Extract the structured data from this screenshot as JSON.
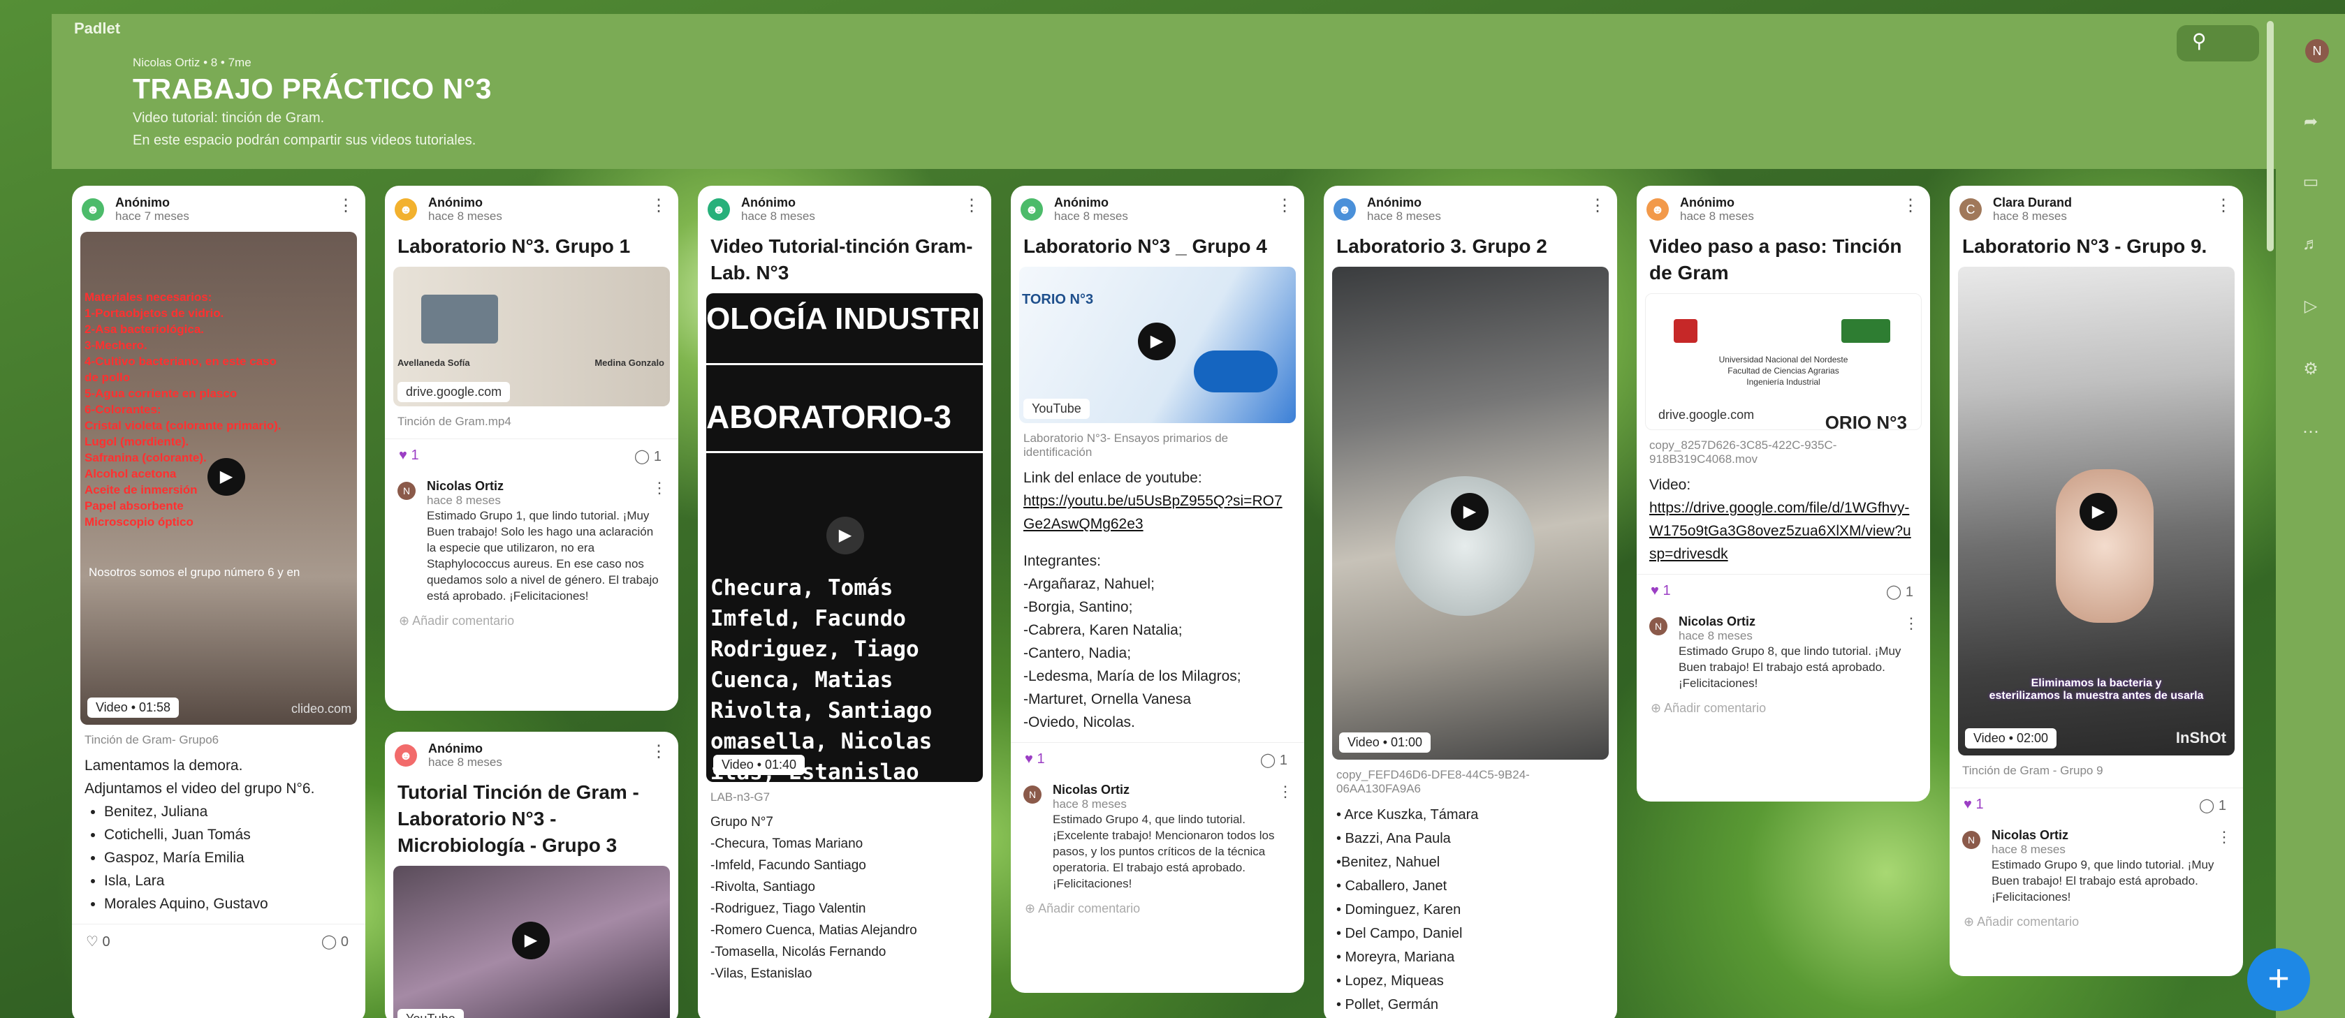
{
  "app": {
    "logo": "Padlet",
    "author_line": "Nicolas Ortiz • 8 • 7me",
    "title": "TRABAJO PRÁCTICO N°3",
    "sub1": "Video tutorial: tinción de Gram.",
    "sub2": "En este espacio podrán compartir sus videos tutoriales.",
    "avatar": "N",
    "fab": "+"
  },
  "icons": {
    "search": "search-icon",
    "share": "share-icon",
    "slideshow": "slideshow-icon",
    "bell": "bell-icon",
    "play": "play-icon",
    "settings": "gear-icon",
    "more": "more-icon"
  },
  "colors": {
    "header": "#7bab55",
    "heart": "#9b3ec4",
    "fab": "#1e88e5"
  },
  "cards": [
    {
      "author": "Anónimo",
      "time": "hace 7 meses",
      "overlay_text": [
        "Materiales necesarios:",
        "1-Portaobjetos de vidrio.",
        "2-Asa bacteriológica.",
        "3-Mechero.",
        "4-Cultivo bacteriano, en este caso",
        "de pollo",
        "5-Agua corriente en plasco",
        "6-Colorantes:",
        "Cristal violeta (colorante primario).",
        "Lugol (mordiente).",
        "Safranina (colorante).",
        "Alcohol acetona",
        "Aceite de inmersión",
        "Papel absorbente",
        "Microscopio óptico"
      ],
      "caption": "Nosotros somos el grupo número 6 y en",
      "badge": "Video • 01:58",
      "watermark": "clideo.com",
      "file": "Tinción de Gram- Grupo6",
      "text1": "Lamentamos la demora.",
      "text2": "Adjuntamos el video del grupo N°6.",
      "list": [
        "Benitez, Juliana",
        "Cotichelli, Juan Tomás",
        "Gaspoz, María Emilia",
        "Isla, Lara",
        "Morales Aquino, Gustavo"
      ],
      "likes": "0",
      "comments": "0"
    },
    {
      "author": "Anónimo",
      "time": "hace 8 meses",
      "title": "Laboratorio N°3. Grupo 1",
      "thumb_left": "Avellaneda Sofía",
      "thumb_right": "Medina Gonzalo",
      "domain": "drive.google.com",
      "file": "Tinción de Gram.mp4",
      "likes": "1",
      "comments": "1",
      "c_name": "Nicolas Ortiz",
      "c_time": "hace 8 meses",
      "c_body": "Estimado Grupo 1, que lindo tutorial. ¡Muy Buen trabajo! Solo les hago una aclaración la especie que utilizaron, no era Staphylococcus aureus. En ese caso nos quedamos solo a nivel de género. El trabajo está aprobado. ¡Felicitaciones!",
      "add": "Añadir comentario"
    },
    {
      "author": "Anónimo",
      "time": "hace 8 meses",
      "title": "Tutorial Tinción de Gram - Laboratorio N°3 - Microbiología - Grupo 3",
      "domain": "YouTube"
    },
    {
      "author": "Anónimo",
      "time": "hace 8 meses",
      "title": "Video Tutorial-tinción Gram-Lab. N°3",
      "big1": "OLOGÍA INDUSTRI",
      "big2": "ABORATORIO-3",
      "names": [
        "Checura, Tomás",
        "Imfeld, Facundo",
        "Rodriguez, Tiago",
        "Cuenca, Matias",
        "Rivolta, Santiago",
        "omasella, Nicolas",
        "ilas, Estanislao"
      ],
      "badge": "Video • 01:40",
      "file": "LAB-n3-G7",
      "group": "Grupo N°7",
      "list": [
        "-Checura, Tomas Mariano",
        "-Imfeld, Facundo Santiago",
        "-Rivolta, Santiago",
        "-Rodriguez, Tiago Valentin",
        "-Romero Cuenca, Matias Alejandro",
        "-Tomasella, Nicolás Fernando",
        "-Vilas, Estanislao"
      ]
    },
    {
      "author": "Anónimo",
      "time": "hace 8 meses",
      "title": "Laboratorio N°3 _ Grupo 4",
      "thumb": "TORIO N°3",
      "domain": "YouTube",
      "file": "Laboratorio N°3- Ensayos primarios de identificación",
      "link_label": "Link del enlace de youtube:",
      "link": "https://youtu.be/u5UsBpZ955Q?si=RO7Ge2AswQMg62e3",
      "integ": "Integrantes:",
      "list": [
        "-Argañaraz, Nahuel;",
        "-Borgia, Santino;",
        "-Cabrera, Karen Natalia;",
        "-Cantero, Nadia;",
        "-Ledesma, María de los Milagros;",
        "-Marturet, Ornella Vanesa",
        "-Oviedo, Nicolas."
      ],
      "likes": "1",
      "comments": "1",
      "c_name": "Nicolas Ortiz",
      "c_time": "hace 8 meses",
      "c_body": "Estimado Grupo 4, que lindo tutorial. ¡Excelente trabajo! Mencionaron todos los pasos, y los puntos críticos de la técnica operatoria. El trabajo está aprobado. ¡Felicitaciones!",
      "add": "Añadir comentario"
    },
    {
      "author": "Anónimo",
      "time": "hace 8 meses",
      "title": "Laboratorio 3. Grupo 2",
      "badge": "Video • 01:00",
      "file": "copy_FEFD46D6-DFE8-44C5-9B24-06AA130FA9A6",
      "list": [
        "• Arce Kuszka, Támara",
        "• Bazzi, Ana Paula",
        "•Benitez, Nahuel",
        "• Caballero, Janet",
        "• Dominguez, Karen",
        "• Del Campo, Daniel",
        "• Moreyra, Mariana",
        "• Lopez, Miqueas",
        "• Pollet, Germán"
      ]
    },
    {
      "author": "Anónimo",
      "time": "hace 8 meses",
      "title": "Video paso a paso: Tinción de Gram",
      "uni1": "Universidad Nacional del Nordeste",
      "uni2": "Facultad de Ciencias Agrarias",
      "uni3": "Ingeniería Industrial",
      "tag": "ORIO N°3",
      "domain": "drive.google.com",
      "file": "copy_8257D626-3C85-422C-935C-918B319C4068.mov",
      "video_label": "Video:",
      "link": "https://drive.google.com/file/d/1WGfhvy-W175o9tGa3G8ovez5zua6XlXM/view?usp=drivesdk",
      "likes": "1",
      "comments": "1",
      "c_name": "Nicolas Ortiz",
      "c_time": "hace 8 meses",
      "c_body": "Estimado Grupo 8, que lindo tutorial. ¡Muy Buen trabajo! El trabajo está aprobado. ¡Felicitaciones!",
      "add": "Añadir comentario"
    },
    {
      "author": "Clara Durand",
      "time": "hace 8 meses",
      "title": "Laboratorio N°3 - Grupo 9.",
      "overlay": "Eliminamos la bacteria  y",
      "overlay2": "esterilizamos la muestra antes de usarla",
      "badge": "Video • 02:00",
      "watermark": "InShOt",
      "file": "Tinción de Gram - Grupo 9",
      "likes": "1",
      "comments": "1",
      "c_name": "Nicolas Ortiz",
      "c_time": "hace 8 meses",
      "c_body": "Estimado Grupo 9, que lindo tutorial. ¡Muy Buen trabajo! El trabajo está aprobado. ¡Felicitaciones!",
      "add": "Añadir comentario"
    }
  ]
}
